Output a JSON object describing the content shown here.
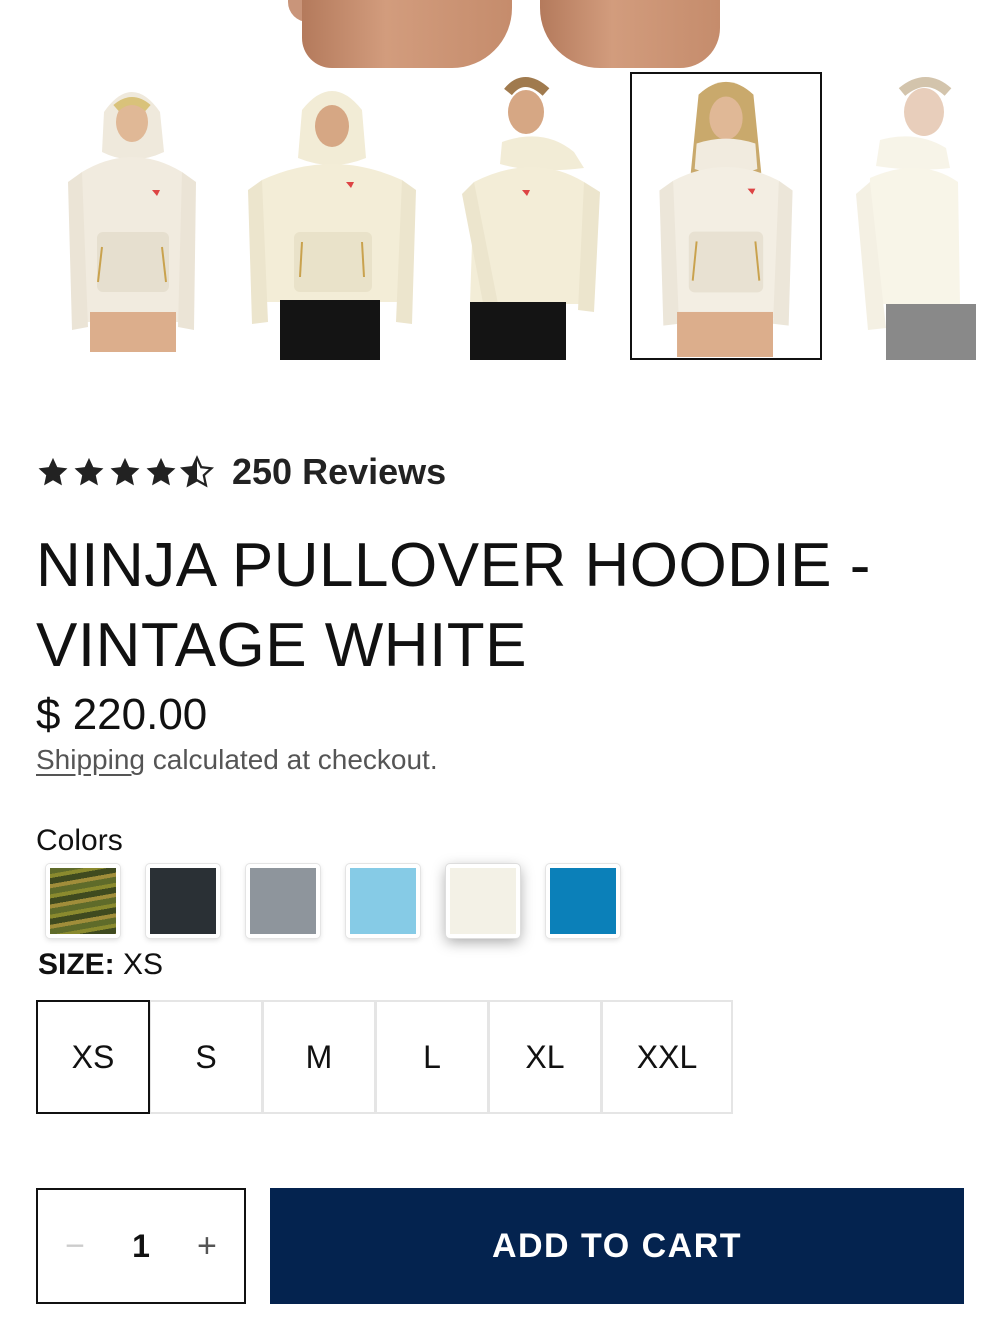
{
  "product": {
    "rating": 4.5,
    "reviews_label": "250 Reviews",
    "title": "NINJA PULLOVER HOODIE - VINTAGE WHITE",
    "price": "$ 220.00",
    "shipping_link": "Shipping",
    "shipping_text": " calculated at checkout."
  },
  "gallery": {
    "thumbnails": [
      {
        "name": "thumbnail-1",
        "model": "woman, hood up",
        "active": false
      },
      {
        "name": "thumbnail-2",
        "model": "man, hood up",
        "active": false
      },
      {
        "name": "thumbnail-3",
        "model": "man, three-quarter view",
        "active": false
      },
      {
        "name": "thumbnail-4",
        "model": "woman, front view",
        "active": true
      },
      {
        "name": "thumbnail-5",
        "model": "man, side view",
        "active": false
      }
    ]
  },
  "colors": {
    "label": "Colors",
    "swatches": [
      {
        "name": "camo",
        "color": "#5f6b2a",
        "selected": false
      },
      {
        "name": "charcoal",
        "color": "#2a3035",
        "selected": false
      },
      {
        "name": "heather-grey",
        "color": "#8e959c",
        "selected": false
      },
      {
        "name": "sky-blue",
        "color": "#86cbe6",
        "selected": false
      },
      {
        "name": "vintage-white",
        "color": "#f3f1e6",
        "selected": true
      },
      {
        "name": "ocean-blue",
        "color": "#0b80b9",
        "selected": false
      }
    ]
  },
  "size": {
    "label": "SIZE:",
    "selected": "XS",
    "options": [
      "XS",
      "S",
      "M",
      "L",
      "XL",
      "XXL"
    ]
  },
  "quantity": {
    "minus": "−",
    "value": "1",
    "plus": "+"
  },
  "cart": {
    "label": "ADD TO CART",
    "color": "#04234f"
  }
}
